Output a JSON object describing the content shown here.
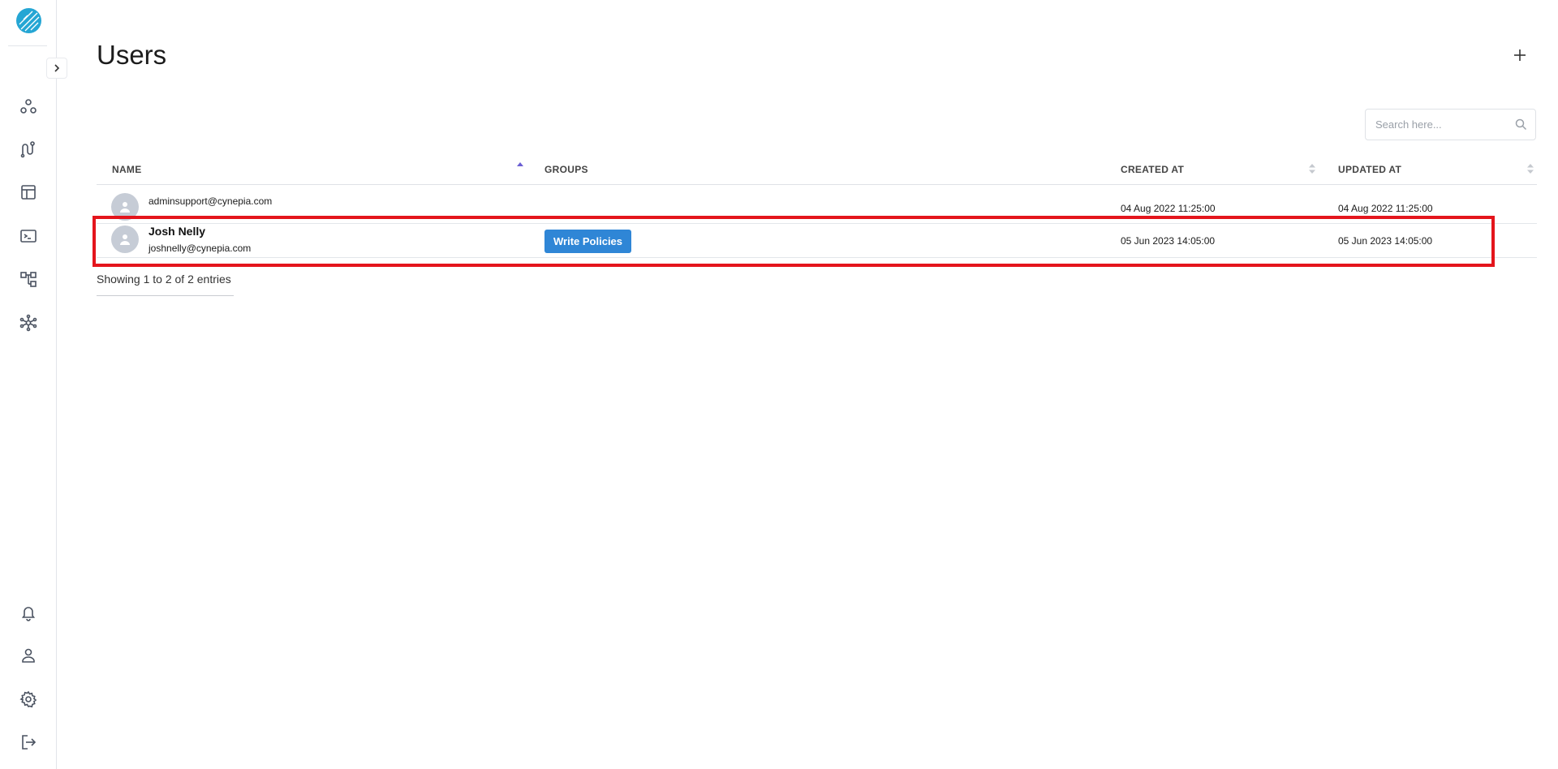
{
  "page": {
    "title": "Users"
  },
  "search": {
    "placeholder": "Search here..."
  },
  "table": {
    "columns": {
      "name": "NAME",
      "groups": "GROUPS",
      "created_at": "CREATED AT",
      "updated_at": "UPDATED AT"
    },
    "rows": [
      {
        "name": "",
        "email": "adminsupport@cynepia.com",
        "groups": [],
        "created_at": "04 Aug 2022 11:25:00",
        "updated_at": "04 Aug 2022 11:25:00"
      },
      {
        "name": "Josh Nelly",
        "email": "joshnelly@cynepia.com",
        "groups": [
          "Write Policies"
        ],
        "created_at": "05 Jun 2023 14:05:00",
        "updated_at": "05 Jun 2023 14:05:00"
      }
    ]
  },
  "footer": {
    "entries_text": "Showing 1 to 2 of 2 entries"
  },
  "colors": {
    "accent": "#2f86d6",
    "logo": "#25a6d4",
    "sort_active": "#6b5fd3",
    "highlight": "#e4151c"
  },
  "icons": {
    "sidebar": [
      "nodes-icon",
      "pipeline-icon",
      "table-icon",
      "terminal-icon",
      "hierarchy-icon",
      "network-icon",
      "bell-icon",
      "user-icon",
      "gear-icon",
      "logout-icon"
    ]
  }
}
